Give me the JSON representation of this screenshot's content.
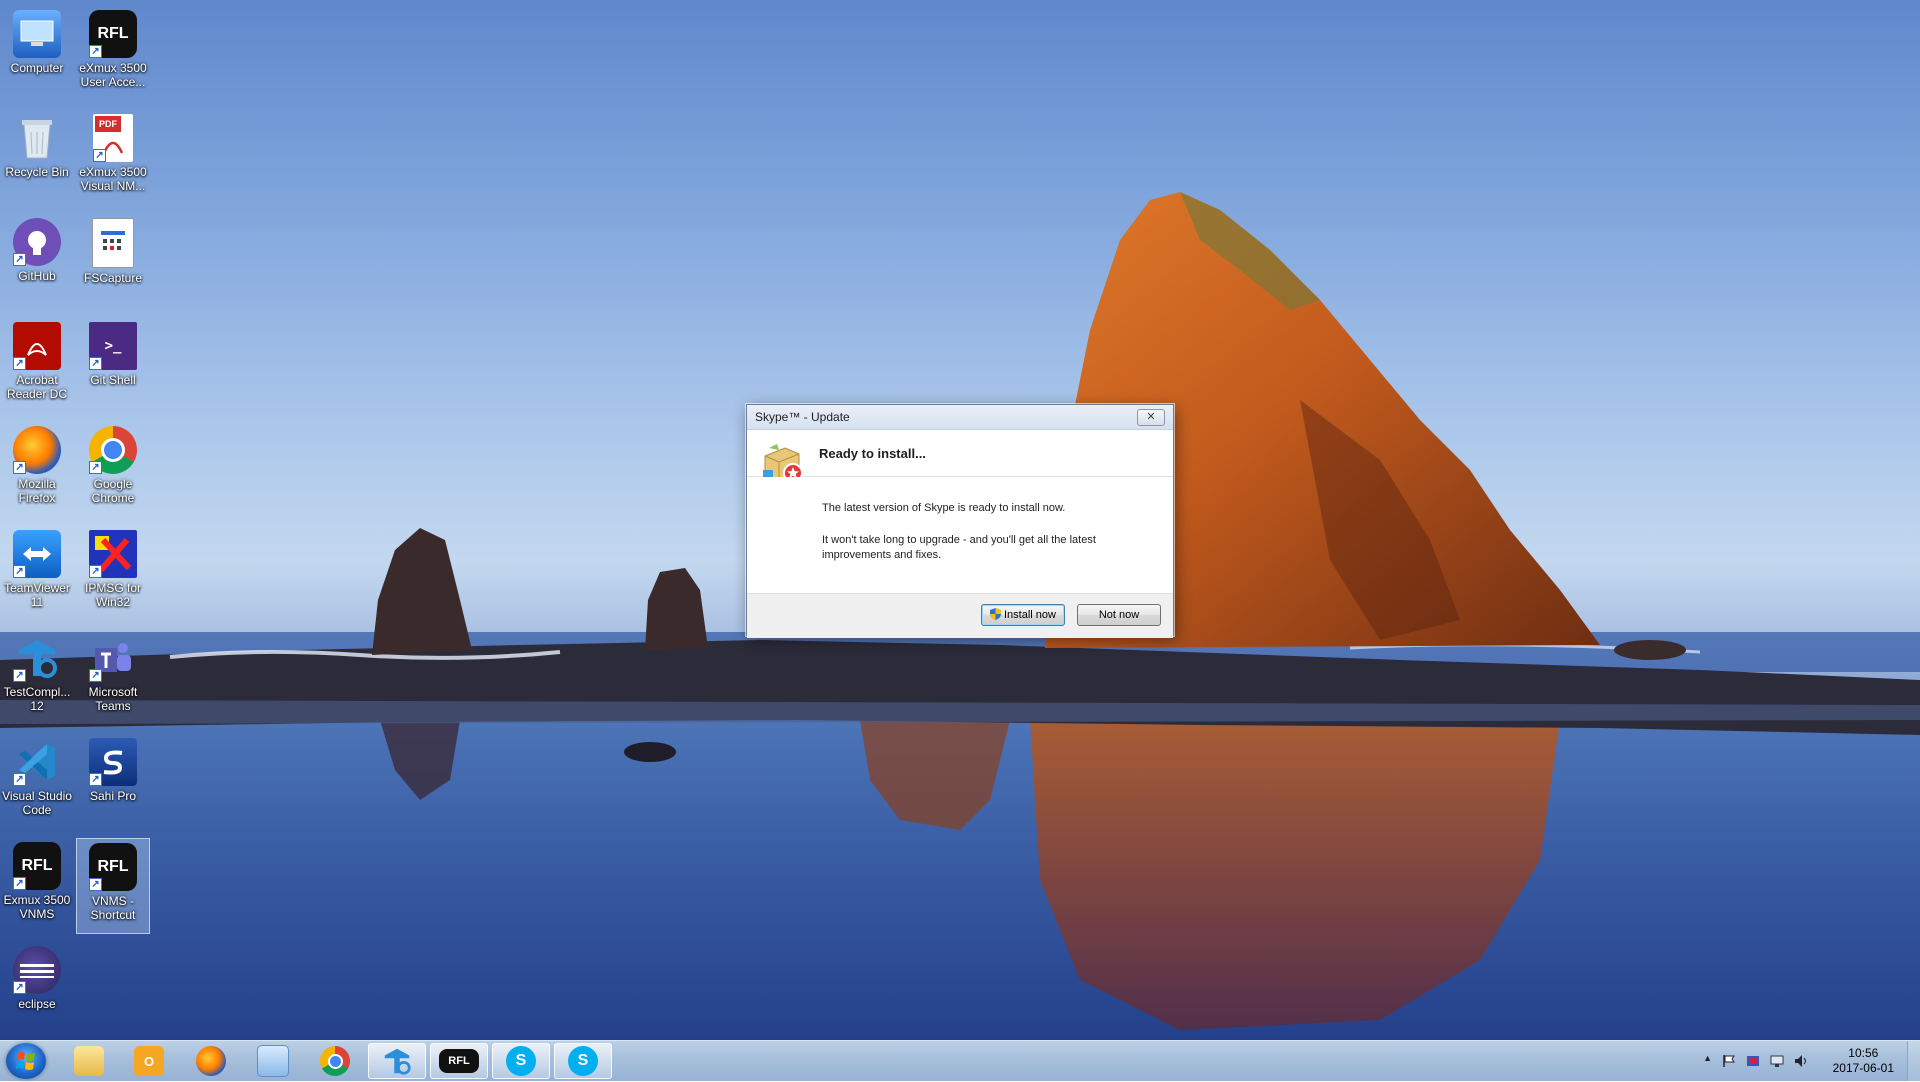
{
  "desktop": {
    "icons": [
      {
        "label": "Computer",
        "icon": "computer-icon"
      },
      {
        "label": "eXmux 3500 User Acce...",
        "icon": "rfl-icon"
      },
      {
        "label": "Recycle Bin",
        "icon": "recycle-bin-icon"
      },
      {
        "label": "eXmux 3500 Visual NM...",
        "icon": "pdf-icon"
      },
      {
        "label": "GitHub",
        "icon": "github-icon"
      },
      {
        "label": "FSCapture",
        "icon": "fscapture-icon"
      },
      {
        "label": "Acrobat Reader DC",
        "icon": "acrobat-icon"
      },
      {
        "label": "Git Shell",
        "icon": "git-shell-icon"
      },
      {
        "label": "Mozilla Firefox",
        "icon": "firefox-icon"
      },
      {
        "label": "Google Chrome",
        "icon": "chrome-icon"
      },
      {
        "label": "TeamViewer 11",
        "icon": "teamviewer-icon"
      },
      {
        "label": "IPMSG for Win32",
        "icon": "ipmsg-icon"
      },
      {
        "label": "TestCompl... 12",
        "icon": "testcomplete-icon"
      },
      {
        "label": "Microsoft Teams",
        "icon": "teams-icon"
      },
      {
        "label": "Visual Studio Code",
        "icon": "vscode-icon"
      },
      {
        "label": "Sahi Pro",
        "icon": "sahi-pro-icon"
      },
      {
        "label": "Exmux 3500 VNMS",
        "icon": "rfl-icon"
      },
      {
        "label": "VNMS - Shortcut",
        "icon": "rfl-icon"
      },
      {
        "label": "eclipse",
        "icon": "eclipse-icon"
      }
    ],
    "rfl_text": "RFL",
    "pdf_text": "PDF",
    "git_shell_text": ">_"
  },
  "dialog": {
    "title": "Skype™ - Update",
    "close_glyph": "✕",
    "heading": "Ready to install...",
    "message_1": "The latest version of Skype is ready to install now.",
    "message_2": "It won't take long to upgrade - and you'll get all the latest improvements and fixes.",
    "install_label": "Install now",
    "not_now_label": "Not now"
  },
  "taskbar": {
    "items": [
      {
        "name": "windows-explorer",
        "icon": "folder-icon"
      },
      {
        "name": "outlook",
        "icon": "outlook-icon"
      },
      {
        "name": "firefox",
        "icon": "firefox-icon"
      },
      {
        "name": "file-manager",
        "icon": "files-icon"
      },
      {
        "name": "chrome",
        "icon": "chrome-icon"
      },
      {
        "name": "testcomplete",
        "icon": "testcomplete-icon"
      },
      {
        "name": "rfl",
        "icon": "rfl-icon"
      },
      {
        "name": "skype-update",
        "icon": "skype-icon"
      },
      {
        "name": "skype",
        "icon": "skype-icon"
      }
    ],
    "rfl_text": "RFL",
    "skype_text": "S",
    "outlook_text": "O",
    "tray_up_glyph": "▲",
    "clock_time": "10:56",
    "clock_date": "2017-06-01"
  },
  "colors": {
    "dialog_default_border": "#3c7fb1",
    "taskbar": "#a7bfdb"
  }
}
